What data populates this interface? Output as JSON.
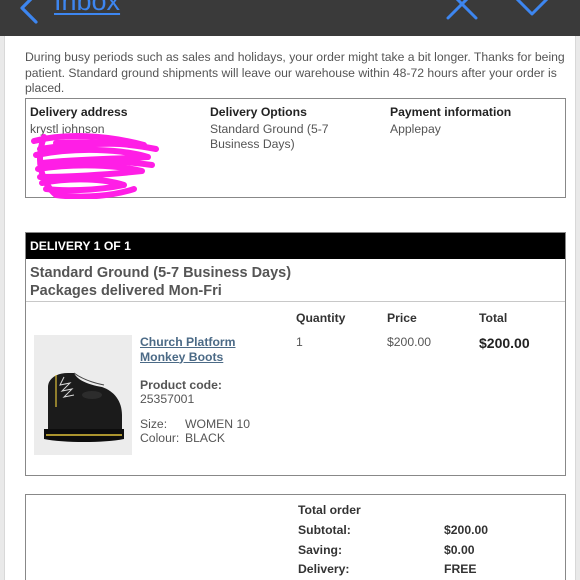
{
  "header": {
    "back_label": "Inbox"
  },
  "notice": "During busy periods such as sales and holidays, your order might take a bit longer. Thanks for being patient. Standard ground shipments will leave our warehouse within 48-72 hours after your order is placed.",
  "info": {
    "delivery_address": {
      "heading": "Delivery address",
      "name": "krystl johnson"
    },
    "delivery_options": {
      "heading": "Delivery Options",
      "value": "Standard Ground (5-7 Business Days)"
    },
    "payment": {
      "heading": "Payment information",
      "value": "Applepay"
    }
  },
  "delivery": {
    "header": "DELIVERY 1 OF 1",
    "method_line1": "Standard Ground (5-7 Business Days)",
    "method_line2": "Packages delivered Mon-Fri",
    "columns": {
      "quantity": "Quantity",
      "price": "Price",
      "total": "Total"
    },
    "item": {
      "name": "Church Platform Monkey Boots",
      "code_label": "Product code:",
      "code": "25357001",
      "size_label": "Size:",
      "size": "WOMEN 10",
      "colour_label": "Colour:",
      "colour": "BLACK",
      "quantity": "1",
      "price": "$200.00",
      "total": "$200.00"
    }
  },
  "summary": {
    "heading": "Total order",
    "subtotal_label": "Subtotal:",
    "subtotal": "$200.00",
    "saving_label": "Saving:",
    "saving": "$0.00",
    "delivery_label": "Delivery:",
    "delivery": "FREE"
  },
  "colors": {
    "accent": "#3d86f0",
    "redaction": "#ff1ee6",
    "link": "#4b6a86"
  },
  "icons": [
    "back-chevron-icon",
    "close-icon",
    "chevron-down-icon"
  ]
}
